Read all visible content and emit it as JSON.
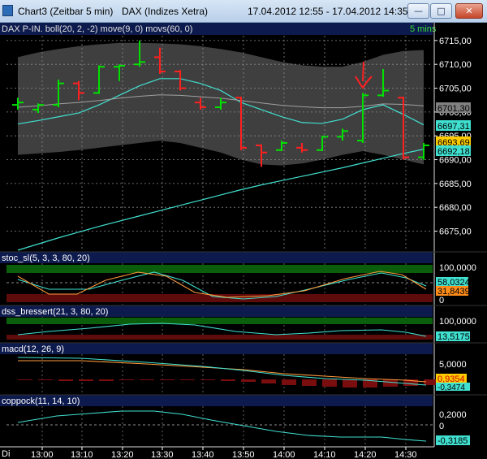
{
  "window": {
    "title_left": "Chart3 (Zeitbar 5 min)",
    "title_mid": "DAX (Indizes Xetra)",
    "date_range": "17.04.2012 12:55 - 17.04.2012 14:35",
    "minimize_glyph": "—",
    "maximize_glyph": "□",
    "close_glyph": "✕"
  },
  "main_panel": {
    "legend": "DAX P-IN. boll(20, 2, -2) move(9, 0) movs(60, 0)",
    "period": "5 mins",
    "y_ticks": [
      "6715,00",
      "6710,00",
      "6705,00",
      "6700,00",
      "6695,00",
      "6690,00",
      "6685,00",
      "6680,00",
      "6675,00"
    ],
    "price_tags": [
      {
        "label": "6701,30",
        "value": 6701.3,
        "bg": "#808080",
        "fg": "#000000"
      },
      {
        "label": "6697,31",
        "value": 6697.31,
        "bg": "#40e0d0",
        "fg": "#000000"
      },
      {
        "label": "6693,69",
        "value": 6693.69,
        "bg": "#ffcc00",
        "fg": "#000000"
      },
      {
        "label": "6692,18",
        "value": 6692.18,
        "bg": "#40e0d0",
        "fg": "#000000"
      }
    ]
  },
  "stoc_panel": {
    "legend": "stoc_sl(5, 3, 3, 80, 20)",
    "y_ticks": [
      "100,0000",
      "0"
    ],
    "tags": [
      {
        "label": "58,0324",
        "bg": "#40e0d0",
        "fg": "#000000"
      },
      {
        "label": "31,8439",
        "bg": "#ff8c1a",
        "fg": "#000000"
      }
    ]
  },
  "dss_panel": {
    "legend": "dss_bressert(21, 3, 80, 20)",
    "y_ticks": [
      "100,0000"
    ],
    "tags": [
      {
        "label": "13,5175",
        "bg": "#40e0d0",
        "fg": "#000000"
      }
    ]
  },
  "macd_panel": {
    "legend": "macd(12, 26, 9)",
    "y_ticks": [
      "5,0000",
      "0"
    ],
    "tags": [
      {
        "label": "0,9354",
        "bg": "#ffcc00",
        "fg": "#cc0000"
      },
      {
        "label": "-0,3474",
        "bg": "#40e0d0",
        "fg": "#000000"
      }
    ]
  },
  "coppock_panel": {
    "legend": "coppock(11, 14, 10)",
    "y_ticks": [
      "0,2000",
      "0"
    ],
    "tags": [
      {
        "label": "-0,3185",
        "bg": "#40e0d0",
        "fg": "#000000"
      }
    ]
  },
  "x_axis": {
    "corner_label": "Di",
    "ticks": [
      "13:00",
      "13:10",
      "13:20",
      "13:30",
      "13:40",
      "13:50",
      "14:00",
      "14:10",
      "14:20",
      "14:30"
    ]
  },
  "colors": {
    "background": "#000000",
    "up_bar": "#00e000",
    "down_bar": "#ff2020",
    "bollinger_band": "#4a4a4a",
    "teal_line": "#40e0d0",
    "orange_line": "#ff9a3c",
    "grid": "#8a8a8a",
    "legend_bg": "#0d1a4d"
  },
  "chart_data": {
    "type": "line",
    "title": "DAX (Indizes Xetra)",
    "xlabel": "",
    "ylabel": "",
    "x": [
      "12:55",
      "13:00",
      "13:05",
      "13:10",
      "13:15",
      "13:20",
      "13:25",
      "13:30",
      "13:35",
      "13:40",
      "13:45",
      "13:50",
      "13:55",
      "14:00",
      "14:05",
      "14:10",
      "14:15",
      "14:20",
      "14:25",
      "14:30",
      "14:35"
    ],
    "ylim": [
      6671,
      6716
    ],
    "ohlc": [
      {
        "o": 6701.5,
        "h": 6703.0,
        "l": 6700.5,
        "c": 6702.0
      },
      {
        "o": 6700.5,
        "h": 6701.8,
        "l": 6699.8,
        "c": 6701.5
      },
      {
        "o": 6701.5,
        "h": 6706.8,
        "l": 6701.0,
        "c": 6706.0
      },
      {
        "o": 6706.0,
        "h": 6706.5,
        "l": 6702.5,
        "c": 6704.0
      },
      {
        "o": 6704.0,
        "h": 6709.8,
        "l": 6703.8,
        "c": 6709.5
      },
      {
        "o": 6709.5,
        "h": 6710.0,
        "l": 6706.5,
        "c": 6709.7
      },
      {
        "o": 6710.0,
        "h": 6715.0,
        "l": 6709.5,
        "c": 6710.5
      },
      {
        "o": 6711.5,
        "h": 6713.5,
        "l": 6708.0,
        "c": 6708.5
      },
      {
        "o": 6708.5,
        "h": 6708.8,
        "l": 6704.5,
        "c": 6705.0
      },
      {
        "o": 6702.0,
        "h": 6703.0,
        "l": 6700.5,
        "c": 6701.0
      },
      {
        "o": 6701.0,
        "h": 6703.0,
        "l": 6700.5,
        "c": 6702.0
      },
      {
        "o": 6703.0,
        "h": 6703.2,
        "l": 6692.0,
        "c": 6692.5
      },
      {
        "o": 6693.0,
        "h": 6693.2,
        "l": 6688.5,
        "c": 6691.5
      },
      {
        "o": 6692.0,
        "h": 6694.0,
        "l": 6691.8,
        "c": 6693.5
      },
      {
        "o": 6692.5,
        "h": 6693.5,
        "l": 6691.5,
        "c": 6692.0
      },
      {
        "o": 6692.0,
        "h": 6695.0,
        "l": 6691.8,
        "c": 6694.8
      },
      {
        "o": 6694.8,
        "h": 6696.5,
        "l": 6694.0,
        "c": 6696.0
      },
      {
        "o": 6694.0,
        "h": 6704.0,
        "l": 6693.5,
        "c": 6703.5
      },
      {
        "o": 6703.5,
        "h": 6709.0,
        "l": 6703.2,
        "c": 6704.5
      },
      {
        "o": 6703.0,
        "h": 6703.2,
        "l": 6690.0,
        "c": 6690.5
      },
      {
        "o": 6690.5,
        "h": 6693.5,
        "l": 6690.0,
        "c": 6693.0
      }
    ],
    "series": [
      {
        "values": [
          6697.5,
          6698.2,
          6699.0,
          6699.8,
          6701.5,
          6703.5,
          6705.5,
          6707.0,
          6707.0,
          6706.0,
          6704.5,
          6702.0,
          6700.5,
          6699.0,
          6697.8,
          6697.6,
          6698.5,
          6700.5,
          6701.5,
          6699.5,
          6697.3
        ]
      },
      {
        "values": [
          6671.0,
          6672.3,
          6673.6,
          6674.8,
          6676.0,
          6677.1,
          6678.2,
          6679.3,
          6680.4,
          6681.5,
          6682.6,
          6683.7,
          6684.7,
          6685.6,
          6686.5,
          6687.4,
          6688.3,
          6689.3,
          6690.3,
          6691.3,
          6692.2
        ]
      },
      {
        "values": [
          6701.0,
          6701.3,
          6701.7,
          6702.0,
          6702.4,
          6702.9,
          6703.3,
          6703.6,
          6703.5,
          6703.2,
          6702.9,
          6702.4,
          6701.9,
          6701.4,
          6701.1,
          6700.9,
          6700.9,
          6701.2,
          6701.7,
          6701.6,
          6701.3
        ]
      },
      {
        "values": [
          6711.5,
          6712.5,
          6713.2,
          6713.8,
          6714.2,
          6714.5,
          6714.5,
          6714.4,
          6714.2,
          6713.8,
          6713.2,
          6712.5,
          6711.5,
          6710.5,
          6709.8,
          6709.5,
          6709.5,
          6710.5,
          6712.0,
          6712.8,
          6713.0
        ]
      },
      {
        "values": [
          6691.0,
          6691.3,
          6691.6,
          6692.0,
          6692.5,
          6693.0,
          6693.5,
          6694.0,
          6693.5,
          6692.5,
          6691.5,
          6690.0,
          6689.0,
          6688.8,
          6689.2,
          6690.0,
          6691.0,
          6691.8,
          6691.0,
          6690.0,
          6689.0
        ]
      }
    ]
  }
}
